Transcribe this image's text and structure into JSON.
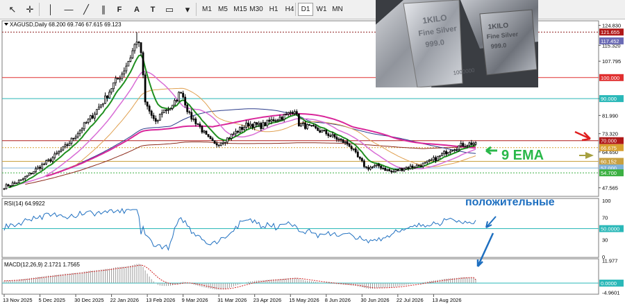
{
  "toolbar": {
    "timeframes": [
      "M1",
      "M5",
      "M15",
      "M30",
      "H1",
      "H4",
      "D1",
      "W1",
      "MN"
    ],
    "active_timeframe": "D1",
    "tools": [
      "cursor-arrow-icon",
      "crosshair-icon",
      "vertical-line-icon",
      "horizontal-line-icon",
      "trendline-icon",
      "channel-icon",
      "fibonacci-icon",
      "text-tool-icon",
      "label-icon",
      "rectangle-icon",
      "shapes-menu-icon"
    ]
  },
  "photo": {
    "bar_front_lines": [
      "1KILO",
      "Fine Silver",
      "999.0"
    ],
    "bar_back_lines": [
      "1KILO",
      "Fine Silver",
      "999.0"
    ],
    "bar_serial": "1000000"
  },
  "chart_data": [
    {
      "type": "candlestick",
      "title": "XAGUSD,Daily  68.200 69.746 67.615 69.123",
      "symbol": "XAGUSD",
      "timeframe": "Daily",
      "ohlc_last": [
        68.2,
        69.746,
        67.615,
        69.123
      ],
      "ylim": [
        43.5,
        127
      ],
      "y_ticks": [
        "124.830",
        "115.320",
        "107.795",
        "90.000",
        "81.990",
        "73.320",
        "64.650",
        "47.565"
      ],
      "x_tick_labels": [
        "13 Nov 2025",
        "5 Dec 2025",
        "30 Dec 2025",
        "22 Jan 2026",
        "13 Feb 2026",
        "9 Mar 2026",
        "31 Mar 2026",
        "23 Apr 2026",
        "15 May 2026",
        "8 Jun 2026",
        "30 Jun 2026",
        "22 Jul 2026",
        "13 Aug 2026"
      ],
      "price_labels": [
        {
          "value": 121.655,
          "text": "121.655",
          "color": "#b01818"
        },
        {
          "value": 117.452,
          "text": "117.452",
          "color": "#6b6bb5"
        },
        {
          "value": 100.0,
          "text": "100.000",
          "color": "#e03030"
        },
        {
          "value": 90.0,
          "text": "90.000",
          "color": "#2ab8b8"
        },
        {
          "value": 70.0,
          "text": "70.000",
          "color": "#b01818"
        },
        {
          "value": 66.675,
          "text": "66.675",
          "color": "#d8a030"
        },
        {
          "value": 60.152,
          "text": "60.152",
          "color": "#c8a040"
        },
        {
          "value": 57.0,
          "text": "57.000",
          "color": "#7fb2d8"
        },
        {
          "value": 54.7,
          "text": "54.700",
          "color": "#3cb043"
        }
      ],
      "horizontal_levels": [
        {
          "value": 121.655,
          "color": "#8b1a1a",
          "style": "dotted"
        },
        {
          "value": 100.0,
          "color": "#e03030",
          "style": "solid"
        },
        {
          "value": 90.0,
          "color": "#2ab8b8",
          "style": "solid"
        },
        {
          "value": 70.0,
          "color": "#b01818",
          "style": "solid"
        },
        {
          "value": 66.675,
          "color": "#d8a030",
          "style": "dotted"
        },
        {
          "value": 60.152,
          "color": "#c8a040",
          "style": "solid"
        },
        {
          "value": 57.0,
          "color": "#7fb2d8",
          "style": "solid"
        },
        {
          "value": 54.7,
          "color": "#3cb043",
          "style": "dotted"
        }
      ],
      "close_anchors": [
        [
          0,
          48
        ],
        [
          8,
          51
        ],
        [
          16,
          57
        ],
        [
          22,
          61
        ],
        [
          30,
          68
        ],
        [
          36,
          75
        ],
        [
          42,
          82
        ],
        [
          48,
          90
        ],
        [
          52,
          97
        ],
        [
          56,
          102
        ],
        [
          60,
          110
        ],
        [
          63,
          118
        ],
        [
          65,
          112
        ],
        [
          67,
          88
        ],
        [
          70,
          82
        ],
        [
          72,
          78
        ],
        [
          75,
          84
        ],
        [
          80,
          86
        ],
        [
          84,
          94
        ],
        [
          88,
          82
        ],
        [
          92,
          78
        ],
        [
          96,
          72
        ],
        [
          100,
          68
        ],
        [
          106,
          71
        ],
        [
          110,
          74
        ],
        [
          116,
          78
        ],
        [
          122,
          77
        ],
        [
          128,
          80
        ],
        [
          134,
          82
        ],
        [
          138,
          85
        ],
        [
          140,
          78
        ],
        [
          146,
          76
        ],
        [
          152,
          74
        ],
        [
          158,
          71
        ],
        [
          164,
          68
        ],
        [
          168,
          62
        ],
        [
          172,
          57
        ],
        [
          178,
          58
        ],
        [
          184,
          55
        ],
        [
          190,
          57
        ],
        [
          196,
          58
        ],
        [
          200,
          59
        ],
        [
          206,
          62
        ],
        [
          212,
          66
        ],
        [
          218,
          68
        ],
        [
          224,
          69.1
        ]
      ],
      "annotations": [
        "9 EMA"
      ],
      "colors": {
        "ema9": "#1f8f1f",
        "pink_ma": "#d9269a",
        "orchid_ma": "#d86dd6",
        "tan_ma": "#e0a050",
        "blue_ma": "#2a3a8a",
        "brown_ma": "#8c2a1a",
        "candles": "#000000",
        "arrow_red": "#e02020",
        "arrow_green": "#2ab84a",
        "arrow_olive": "#a6a040"
      }
    },
    {
      "type": "line",
      "title": "RSI(14) 64.9922",
      "indicator": "RSI",
      "period": 14,
      "value": 64.9922,
      "ylim": [
        0,
        100
      ],
      "y_ticks": [
        "100",
        "70",
        "30",
        "0"
      ],
      "level": {
        "value": 50,
        "text": "50.0000",
        "color": "#2ab8b8"
      },
      "annotation": "положительные",
      "line_color": "#1e6fc0"
    },
    {
      "type": "bar",
      "title": "MACD(12,26,9) 2.1721 1.7565",
      "indicator": "MACD",
      "params": [
        12,
        26,
        9
      ],
      "macd": 2.1721,
      "signal": 1.7565,
      "ylim": [
        -5.5,
        12.5
      ],
      "y_ticks": [
        "11.977",
        "0.0000",
        "-4.9601"
      ],
      "zero_label": {
        "value": 0,
        "text": "0.0000",
        "color": "#2ab8b8"
      },
      "histogram_color": "#9a9a9a",
      "signal_color": "#d02020"
    }
  ]
}
